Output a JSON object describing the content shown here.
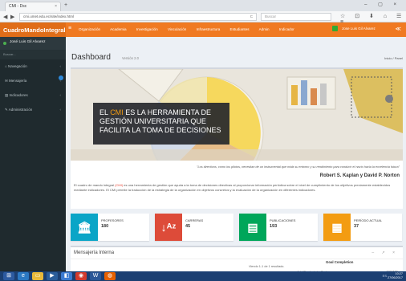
{
  "browser": {
    "tab_title": "CMI - Dsc",
    "tab_close": "×",
    "new_tab": "+",
    "window_controls": "– ▢ ×",
    "back": "◀",
    "forward": "▶",
    "url": "cmi.umet.edu.ec/site/index.html",
    "search_placeholder": "Buscar",
    "reload": "C"
  },
  "header": {
    "brand": "CuadroMandoIntegral",
    "menu": [
      "Organización",
      "Academia",
      "Investigación",
      "Vinculación",
      "Infraestructura",
      "Estudiantes",
      "Admin",
      "Indicador"
    ],
    "user_name": "Jose Luis Gil Alvarez"
  },
  "sidebar": {
    "user": "José Luis Gil Alvarez",
    "search": "Buscar...",
    "items": [
      {
        "label": "Navegación"
      },
      {
        "label": "Mensajería"
      },
      {
        "label": "Indicadores"
      },
      {
        "label": "Administración"
      }
    ]
  },
  "page": {
    "title": "Dashboard",
    "subtitle": "Versión 2.0",
    "breadcrumb": "Inicio / Panel"
  },
  "hero": {
    "line1_pre": "EL ",
    "line1_highlight": "CMI",
    "line1_post": " ES LA HERRAMIENTA DE",
    "line2": "GESTIÓN UNIVERSITARIA QUE",
    "line3": "FACILITA LA TOMA DE DECISIONES",
    "quote": "\"Los directivos, como los pilotos, necesitan de un instrumental que mida su entorno y su rendimiento para conducir el navío hacia la excelencia futura\"",
    "author": "Robert S. Kaplan y David P. Norton",
    "para_pre": "El cuadro de mando integral ",
    "para_highlight": "(CMI)",
    "para_post": " es una herramienta de gestión que ayuda a la toma de decisiones directivas al proporcionar información periódica sobre el nivel de cumplimiento de los objetivos previamente establecidos mediante indicadores. El CMI permite la traducción de la estrategia de la organización en objetivos concretos y la evaluación de la organización en diferentes indicadores."
  },
  "stats": [
    {
      "label": "PROFESORES",
      "value": "180",
      "color": "#0aa5c7",
      "icon": "bank-icon"
    },
    {
      "label": "CARRERAS",
      "value": "45",
      "color": "#dd4b39",
      "icon": "sort-az-icon"
    },
    {
      "label": "PUBLICACIONES",
      "value": "193",
      "color": "#00a65a",
      "icon": "book-icon"
    },
    {
      "label": "PERÍODO ACTUAL",
      "value": "37",
      "color": "#f39c12",
      "icon": "calendar-icon"
    }
  ],
  "messaging": {
    "title": "Mensajería Interna",
    "tools": "– ↗ ×",
    "goal_title": "Goal Completion",
    "showing": "Viendo 1-1 de 1 resultado.",
    "add_products_label": "Add Products to Cart",
    "add_products_value": "160/200",
    "progress": 0.8
  },
  "taskbar": {
    "time": "10:27",
    "date": "27/06/2017",
    "lang": "ES"
  },
  "colors": {
    "header": "#f07a22",
    "sidebar": "#1f2a2e",
    "accent": "#f39c12"
  }
}
